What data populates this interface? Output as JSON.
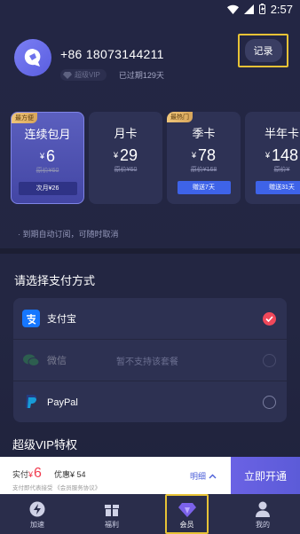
{
  "status_bar": {
    "time": "2:57"
  },
  "profile": {
    "phone": "+86 18073144211",
    "vip_badge": "超级VIP",
    "expired_text": "已过期129天"
  },
  "record_button": "记录",
  "plans": [
    {
      "name": "连续包月",
      "tag": "最方便",
      "currency": "¥",
      "price": "6",
      "original": "原价¥60",
      "promo": "次月¥26",
      "selected": true
    },
    {
      "name": "月卡",
      "tag": "",
      "currency": "¥",
      "price": "29",
      "original": "原价¥60",
      "promo": "",
      "selected": false
    },
    {
      "name": "季卡",
      "tag": "最热门",
      "currency": "¥",
      "price": "78",
      "original": "原价¥168",
      "promo": "赠送7天",
      "selected": false
    },
    {
      "name": "半年卡",
      "tag": "",
      "currency": "¥",
      "price": "148",
      "original": "原价¥",
      "promo": "赠送31天",
      "selected": false
    }
  ],
  "auto_renew_note": "· 到期自动订阅，可随时取消",
  "payment": {
    "title": "请选择支付方式",
    "methods": [
      {
        "name": "支付宝",
        "note": "",
        "icon": "alipay-icon",
        "checked": true,
        "disabled": false
      },
      {
        "name": "微信",
        "note": "暂不支持该套餐",
        "icon": "wechat-icon",
        "checked": false,
        "disabled": true
      },
      {
        "name": "PayPal",
        "note": "",
        "icon": "paypal-icon",
        "checked": false,
        "disabled": false
      }
    ]
  },
  "svip_title": "超级VIP特权",
  "pay_bar": {
    "paid_label": "实付",
    "paid_currency": "¥",
    "paid_amount": "6",
    "discount": "优惠¥ 54",
    "agreement": "支付即代表接受 《会员服务协议》",
    "details": "明细",
    "open_button": "立即开通"
  },
  "tabs": [
    {
      "label": "加速",
      "icon": "bolt-icon",
      "active": false
    },
    {
      "label": "福利",
      "icon": "gift-icon",
      "active": false
    },
    {
      "label": "会员",
      "icon": "diamond-icon",
      "active": true
    },
    {
      "label": "我的",
      "icon": "user-icon",
      "active": false
    }
  ],
  "colors": {
    "accent": "#6a62e4",
    "price_red": "#f03c4f",
    "highlight_box": "#e7c236",
    "alipay_blue": "#1677ff"
  }
}
